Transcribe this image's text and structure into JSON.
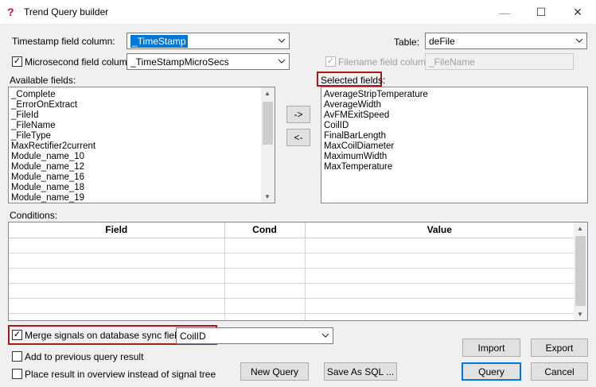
{
  "window": {
    "title": "Trend Query builder",
    "minimize": "—",
    "maximize": "☐",
    "close": "✕"
  },
  "timestamp": {
    "label": "Timestamp field column:",
    "value": "_TimeStamp"
  },
  "table": {
    "label": "Table:",
    "value": "deFile"
  },
  "microsecond": {
    "label": "Microsecond field column:",
    "value": "_TimeStampMicroSecs",
    "checked": true
  },
  "filename": {
    "label": "Filename field column:",
    "value": "_FileName",
    "checked": true
  },
  "available": {
    "label": "Available fields:",
    "items": [
      "_Complete",
      "_ErrorOnExtract",
      "_FileId",
      "_FileName",
      "_FileType",
      "MaxRectifier2current",
      "Module_name_10",
      "Module_name_12",
      "Module_name_16",
      "Module_name_18",
      "Module_name_19"
    ]
  },
  "move_buttons": {
    "add": "->",
    "remove": "<-"
  },
  "selected": {
    "label": "Selected fields:",
    "items": [
      "AverageStripTemperature",
      "AverageWidth",
      "AvFMExitSpeed",
      "CoilID",
      "FinalBarLength",
      "MaxCoilDiameter",
      "MaximumWidth",
      "MaxTemperature"
    ]
  },
  "conditions": {
    "label": "Conditions:",
    "columns": [
      "Field",
      "Cond",
      "Value"
    ]
  },
  "merge": {
    "label": "Merge signals on database sync field:",
    "value": "CoilID",
    "checked": true
  },
  "options": {
    "add_previous": "Add to previous query result",
    "place_overview": "Place result in overview instead of signal tree"
  },
  "buttons": {
    "import": "Import",
    "export": "Export",
    "new_query": "New Query",
    "save_sql": "Save As SQL ...",
    "query": "Query",
    "cancel": "Cancel"
  },
  "glyphs": {
    "check": "✓",
    "up": "▲",
    "down": "▼"
  },
  "colors": {
    "highlight": "#a21a1a",
    "selection": "#0078d7",
    "app_icon": "#c8102e"
  }
}
